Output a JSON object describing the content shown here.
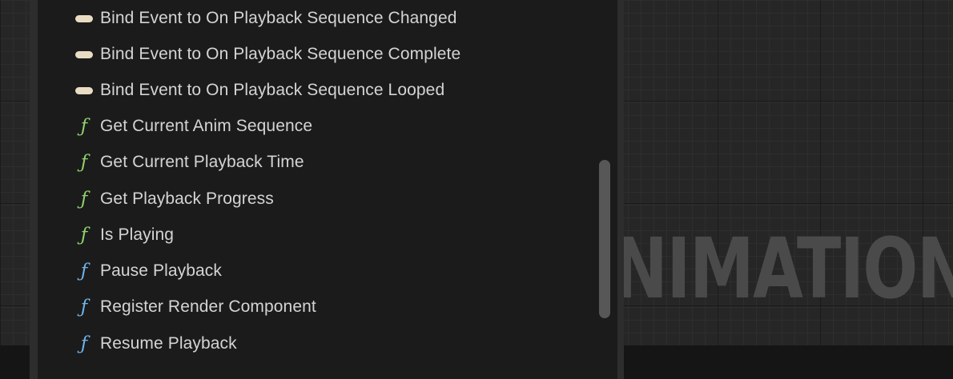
{
  "background": {
    "watermark_text": "NIMATION"
  },
  "menu": {
    "items": [
      {
        "label": "Bind Event to On Playback Sequence Changed",
        "kind": "event",
        "icon": "event-pill-icon",
        "icon_color": "#e9dcc3"
      },
      {
        "label": "Bind Event to On Playback Sequence Complete",
        "kind": "event",
        "icon": "event-pill-icon",
        "icon_color": "#e9dcc3"
      },
      {
        "label": "Bind Event to On Playback Sequence Looped",
        "kind": "event",
        "icon": "event-pill-icon",
        "icon_color": "#e9dcc3"
      },
      {
        "label": "Get Current Anim Sequence",
        "kind": "pure-function",
        "icon": "function-icon",
        "icon_color": "#8fd16d"
      },
      {
        "label": "Get Current Playback Time",
        "kind": "pure-function",
        "icon": "function-icon",
        "icon_color": "#8fd16d"
      },
      {
        "label": "Get Playback Progress",
        "kind": "pure-function",
        "icon": "function-icon",
        "icon_color": "#8fd16d"
      },
      {
        "label": "Is Playing",
        "kind": "pure-function",
        "icon": "function-icon",
        "icon_color": "#8fd16d"
      },
      {
        "label": "Pause Playback",
        "kind": "function",
        "icon": "function-icon",
        "icon_color": "#6fb3e8"
      },
      {
        "label": "Register Render Component",
        "kind": "function",
        "icon": "function-icon",
        "icon_color": "#6fb3e8"
      },
      {
        "label": "Resume Playback",
        "kind": "function",
        "icon": "function-icon",
        "icon_color": "#6fb3e8"
      }
    ]
  },
  "colors": {
    "panel_bg": "#1b1b1b",
    "panel_border": "#2d2d2d",
    "text": "#d4d4d4",
    "scrollbar": "#575757"
  }
}
